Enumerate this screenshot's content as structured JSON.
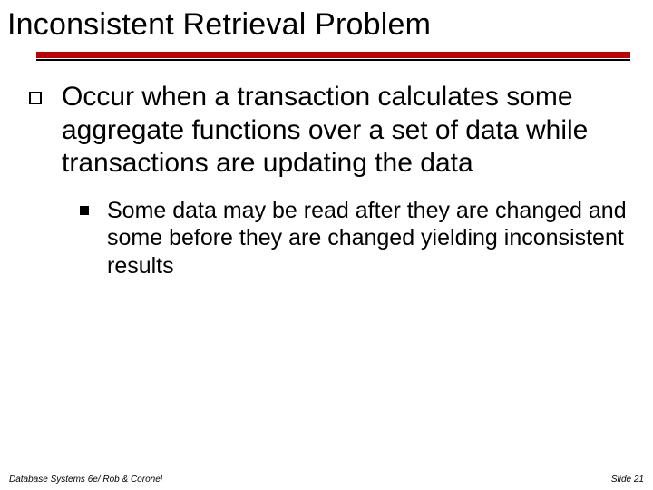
{
  "title": "Inconsistent Retrieval Problem",
  "bullets": {
    "lvl1": "Occur when a transaction calculates some aggregate functions over a set of data while transactions are updating the data",
    "lvl2": "Some data may be read after they are changed and some before they are changed yielding inconsistent results"
  },
  "footer": {
    "left": "Database Systems 6e/ Rob & Coronel",
    "right": "Slide 21"
  },
  "colors": {
    "accent": "#c00000"
  }
}
